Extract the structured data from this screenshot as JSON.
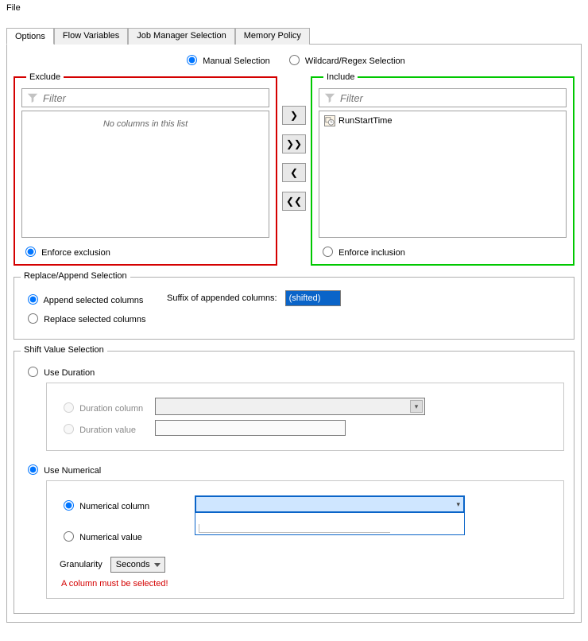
{
  "menu": {
    "file": "File"
  },
  "tabs": [
    "Options",
    "Flow Variables",
    "Job Manager Selection",
    "Memory Policy"
  ],
  "selection_mode": {
    "manual": "Manual Selection",
    "wildcard": "Wildcard/Regex Selection"
  },
  "exclude": {
    "legend": "Exclude",
    "filter_placeholder": "Filter",
    "empty_msg": "No columns in this list",
    "enforce": "Enforce exclusion"
  },
  "include": {
    "legend": "Include",
    "filter_placeholder": "Filter",
    "items": [
      "RunStartTime"
    ],
    "enforce": "Enforce inclusion"
  },
  "arrows": {
    "right": "❯",
    "right_all": "❯❯",
    "left": "❮",
    "left_all": "❮❮"
  },
  "replace_append": {
    "title": "Replace/Append Selection",
    "append": "Append selected columns",
    "replace": "Replace selected columns",
    "suffix_label": "Suffix of appended columns:",
    "suffix_value": "(shifted)"
  },
  "shift": {
    "title": "Shift Value Selection",
    "use_duration": "Use Duration",
    "duration_column": "Duration column",
    "duration_value": "Duration value",
    "use_numerical": "Use Numerical",
    "numerical_column": "Numerical column",
    "numerical_value": "Numerical value",
    "gran_label": "Granularity",
    "gran_value": "Seconds",
    "error": "A column must be selected!"
  }
}
